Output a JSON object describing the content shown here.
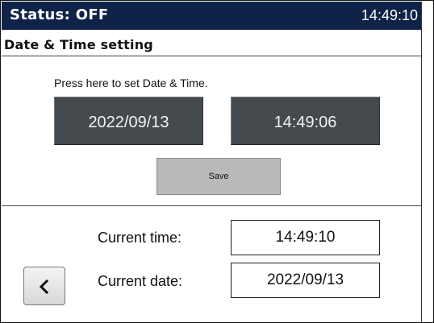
{
  "status_bar": {
    "status_text": "Status: OFF",
    "clock": "14:49:10",
    "background": "#0f2349"
  },
  "page": {
    "title": "Date & Time setting"
  },
  "setter": {
    "hint": "Press here to set Date & Time.",
    "date_value": "2022/09/13",
    "time_value": "14:49:06",
    "save_label": "Save"
  },
  "current": {
    "time_label": "Current time:",
    "time_value": "14:49:10",
    "date_label": "Current date:",
    "date_value": "2022/09/13"
  },
  "nav": {
    "back_icon": "chevron-left-icon"
  }
}
